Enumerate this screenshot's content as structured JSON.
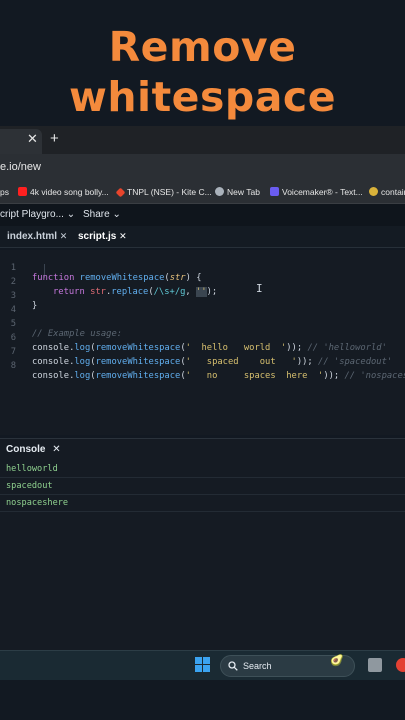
{
  "overlay": {
    "line1": "Remove",
    "line2": "whitespace"
  },
  "browser": {
    "tab_close": "✕",
    "new_tab": "+",
    "url": "e.io/new",
    "bookmarks": [
      {
        "label": "ps",
        "color": "#2b2f34"
      },
      {
        "label": "4k video song bolly...",
        "color": "#ff2020"
      },
      {
        "label": "TNPL (NSE) - Kite C...",
        "color": "#e8452c"
      },
      {
        "label": "New Tab",
        "color": "#aab2bb"
      },
      {
        "label": "Voicemaker® - Text...",
        "color": "#6a5cf0"
      },
      {
        "label": "contain",
        "color": "#d9b23a"
      }
    ]
  },
  "app": {
    "project": "cript Playgro...",
    "share": "Share",
    "files": [
      {
        "label": "index.html",
        "close": "✕"
      },
      {
        "label": "script.js",
        "close": "✕"
      }
    ]
  },
  "editor": {
    "line_numbers": [
      "1",
      "2",
      "3",
      "4",
      "5",
      "6",
      "7",
      "8"
    ],
    "l1": {
      "kw": "function",
      "fn": "removeWhitespace",
      "open": "(",
      "param": "str",
      "close": ") {"
    },
    "l2": {
      "kw": "return",
      "obj": "str",
      "dot": ".",
      "method": "replace",
      "open": "(",
      "regex": "/\\s+/g",
      "comma": ", ",
      "quotes": "''",
      "close": ");"
    },
    "l3": {
      "text": "}"
    },
    "l5": {
      "comment": "// Example usage:"
    },
    "calls": [
      {
        "obj": "console",
        "dot": ".",
        "method": "log",
        "open": "(",
        "fn": "removeWhitespace",
        "open2": "(",
        "arg": "'  hello   world  '",
        "close": ")); ",
        "comment": "// 'helloworld'"
      },
      {
        "obj": "console",
        "dot": ".",
        "method": "log",
        "open": "(",
        "fn": "removeWhitespace",
        "open2": "(",
        "arg": "'   spaced    out   '",
        "close": ")); ",
        "comment": "// 'spacedout'"
      },
      {
        "obj": "console",
        "dot": ".",
        "method": "log",
        "open": "(",
        "fn": "removeWhitespace",
        "open2": "(",
        "arg": "'   no     spaces  here  '",
        "close": ")); ",
        "comment": "// 'nospacesh"
      }
    ]
  },
  "console": {
    "title": "Console",
    "close": "✕",
    "output": [
      "helloworld",
      "spacedout",
      "nospaceshere"
    ]
  },
  "taskbar": {
    "search": "Search"
  }
}
